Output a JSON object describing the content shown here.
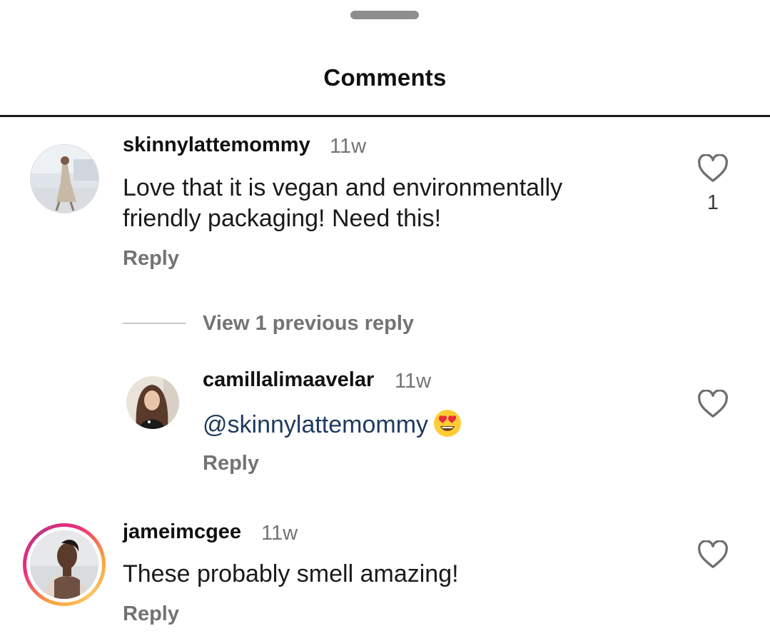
{
  "header": {
    "title": "Comments"
  },
  "comments": [
    {
      "username": "skinnylattemommy",
      "time": "11w",
      "text_line1": "Love that it is vegan and environmentally",
      "text_line2": "friendly packaging! Need this!",
      "reply_label": "Reply",
      "like_count": "1",
      "view_replies_label": "View 1 previous reply",
      "replies": [
        {
          "username": "camillalimaavelar",
          "time": "11w",
          "mention": "@skinnylattemommy",
          "emoji": "heart-eyes-emoji",
          "reply_label": "Reply"
        }
      ]
    },
    {
      "username": "jameimcgee",
      "time": "11w",
      "text": "These probably smell amazing!",
      "reply_label": "Reply",
      "has_story_ring": true
    }
  ],
  "colors": {
    "secondary_text": "#737373",
    "mention": "#1f3a5f",
    "divider": "#1a1a1a"
  }
}
